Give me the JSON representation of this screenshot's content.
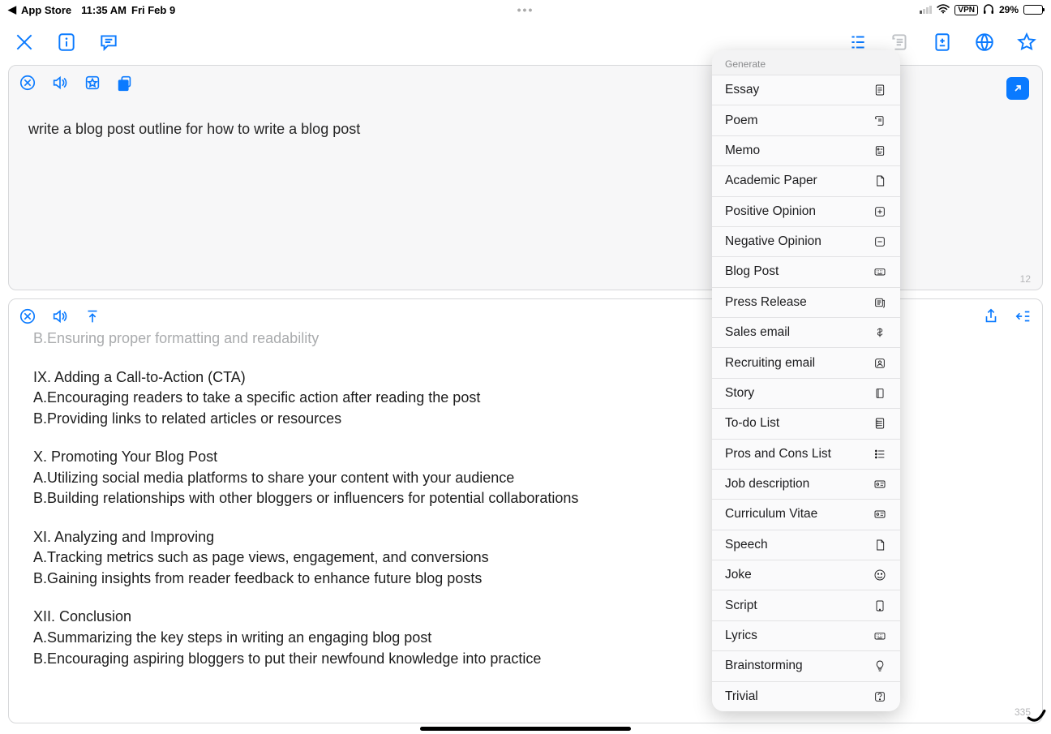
{
  "status": {
    "back_app": "App Store",
    "time": "11:35 AM",
    "date": "Fri Feb 9",
    "vpn": "VPN",
    "battery_pct": "29%"
  },
  "input_panel": {
    "prompt": "write a blog post outline for how to write a blog post",
    "word_count": "12"
  },
  "output_panel": {
    "truncated_line": "B.Ensuring proper formatting and readability",
    "sections": [
      {
        "h": "IX. Adding a Call-to-Action (CTA)",
        "a": "A.Encouraging readers to take a specific action after reading the post",
        "b": "B.Providing links to related articles or resources"
      },
      {
        "h": "X. Promoting Your Blog Post",
        "a": "A.Utilizing social media platforms to share your content with your audience",
        "b": "B.Building relationships with other bloggers or influencers for potential collaborations"
      },
      {
        "h": "XI. Analyzing and Improving",
        "a": "A.Tracking metrics such as page views, engagement, and conversions",
        "b": "B.Gaining insights from reader feedback to enhance future blog posts"
      },
      {
        "h": "XII. Conclusion",
        "a": "A.Summarizing the key steps in writing an engaging blog post",
        "b": "B.Encouraging aspiring bloggers to put their newfound knowledge into practice"
      }
    ],
    "word_count": "335"
  },
  "generate_menu": {
    "header": "Generate",
    "items": [
      {
        "label": "Essay",
        "icon": "doc"
      },
      {
        "label": "Poem",
        "icon": "scroll"
      },
      {
        "label": "Memo",
        "icon": "memo"
      },
      {
        "label": "Academic Paper",
        "icon": "page"
      },
      {
        "label": "Positive Opinion",
        "icon": "plus"
      },
      {
        "label": "Negative Opinion",
        "icon": "minus"
      },
      {
        "label": "Blog Post",
        "icon": "keyboard"
      },
      {
        "label": "Press Release",
        "icon": "news"
      },
      {
        "label": "Sales email",
        "icon": "dollar"
      },
      {
        "label": "Recruiting email",
        "icon": "person"
      },
      {
        "label": "Story",
        "icon": "book"
      },
      {
        "label": "To-do List",
        "icon": "list"
      },
      {
        "label": "Pros and Cons List",
        "icon": "bullets"
      },
      {
        "label": "Job description",
        "icon": "card"
      },
      {
        "label": "Curriculum Vitae",
        "icon": "card"
      },
      {
        "label": "Speech",
        "icon": "page"
      },
      {
        "label": "Joke",
        "icon": "smiley"
      },
      {
        "label": "Script",
        "icon": "tablet"
      },
      {
        "label": "Lyrics",
        "icon": "keyboard"
      },
      {
        "label": "Brainstorming",
        "icon": "bulb"
      },
      {
        "label": "Trivial",
        "icon": "question"
      }
    ]
  }
}
